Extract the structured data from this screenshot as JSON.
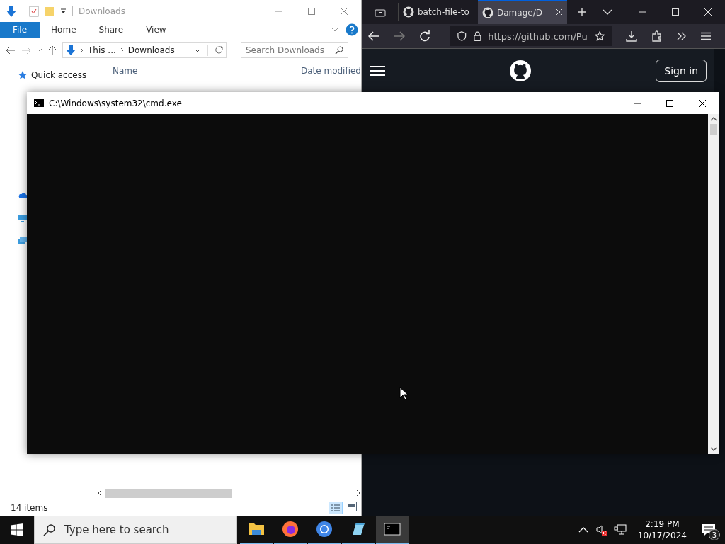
{
  "explorer": {
    "title": "Downloads",
    "ribbon_tabs": [
      {
        "label": "File",
        "selected": true
      },
      {
        "label": "Home",
        "selected": false
      },
      {
        "label": "Share",
        "selected": false
      },
      {
        "label": "View",
        "selected": false
      }
    ],
    "breadcrumb": [
      "This ...",
      "Downloads"
    ],
    "search": {
      "placeholder": "Search Downloads"
    },
    "columns": [
      "Name",
      "Date modified"
    ],
    "nav_items": [
      {
        "kind": "star",
        "label": "Quick access"
      },
      {
        "kind": "cloud"
      },
      {
        "kind": "computer"
      },
      {
        "kind": "network"
      }
    ],
    "status_bar": "14 items"
  },
  "browser": {
    "tabs": [
      {
        "title": "batch-file-to",
        "selected": false
      },
      {
        "title": "Damage/D",
        "selected": true
      }
    ],
    "url": "https://github.com/Pu",
    "sign_in": "Sign in"
  },
  "console": {
    "title": "C:\\Windows\\system32\\cmd.exe"
  },
  "taskbar": {
    "search": {
      "placeholder": "Type here to search"
    },
    "apps": [
      {
        "kind": "folder",
        "selected": false
      },
      {
        "kind": "firefox",
        "selected": false
      },
      {
        "kind": "chrome",
        "selected": false
      },
      {
        "kind": "notepad",
        "selected": false
      },
      {
        "kind": "terminal",
        "selected": true
      }
    ],
    "time": "2:19 PM",
    "date": "10/17/2024",
    "notifications": "3"
  }
}
